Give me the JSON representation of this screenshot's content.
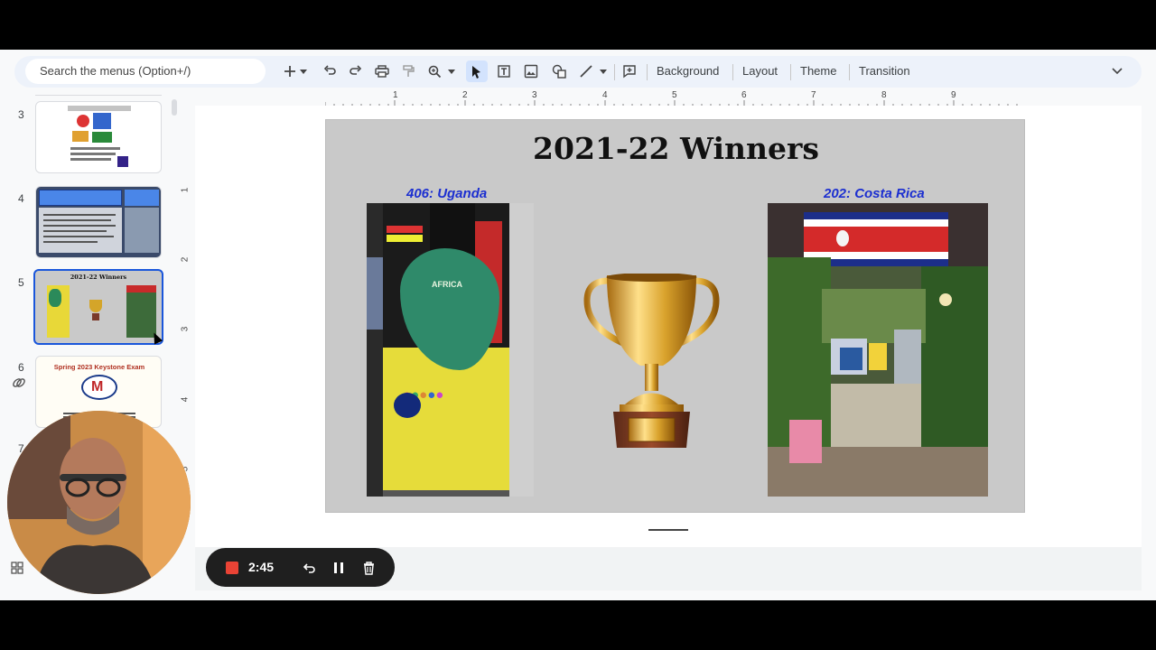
{
  "toolbar": {
    "search_placeholder": "Search the menus (Option+/)",
    "background_label": "Background",
    "layout_label": "Layout",
    "theme_label": "Theme",
    "transition_label": "Transition"
  },
  "filmstrip": {
    "slides": [
      {
        "number": "3"
      },
      {
        "number": "4",
        "title": "Manheim's Culture Fest Door Decorating Contest"
      },
      {
        "number": "5",
        "title": "2021-22 Winners"
      },
      {
        "number": "6",
        "title": "Spring 2023 Keystone Exam"
      },
      {
        "number": "7"
      }
    ]
  },
  "rulers": {
    "horizontal": [
      "1",
      "2",
      "3",
      "4",
      "5",
      "6",
      "7",
      "8",
      "9"
    ],
    "vertical": [
      "1",
      "2",
      "3",
      "4",
      "5"
    ]
  },
  "slide": {
    "title": "2021-22 Winners",
    "left_caption": "406: Uganda",
    "right_caption": "202: Costa Rica",
    "door_text": "AFRICA"
  },
  "recorder": {
    "time": "2:45"
  },
  "icons": {
    "add": "plus-icon",
    "undo": "undo-icon",
    "redo": "redo-icon",
    "print": "print-icon",
    "paint_format": "paint-format-icon",
    "zoom": "zoom-icon",
    "select": "cursor-icon",
    "textbox": "textbox-icon",
    "image": "image-icon",
    "shape": "shape-icon",
    "line": "line-icon",
    "comment": "comment-icon",
    "collapse": "chevron-down-icon"
  }
}
